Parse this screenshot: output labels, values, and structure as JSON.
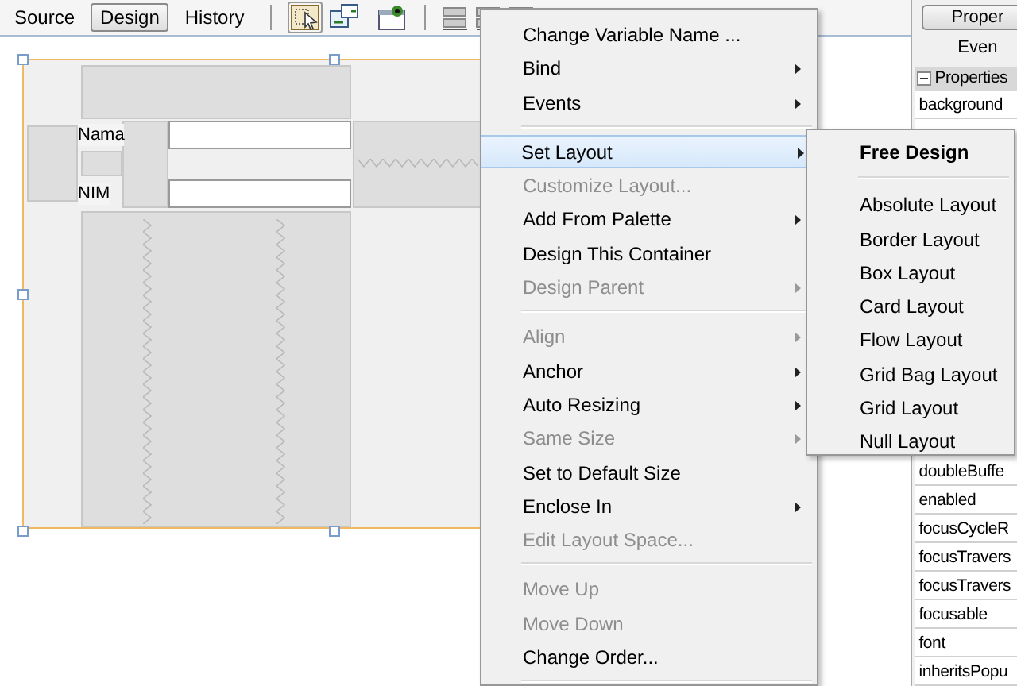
{
  "editor_tabs": [
    {
      "label": "Source",
      "selected": false
    },
    {
      "label": "Design",
      "selected": true
    },
    {
      "label": "History",
      "selected": false
    }
  ],
  "form": {
    "fields": [
      {
        "label": "Nama"
      },
      {
        "label": "NIM"
      }
    ]
  },
  "context_menu": {
    "items": [
      {
        "kind": "item",
        "label": "Change Variable Name ...",
        "disabled": false,
        "submenu": false,
        "highlighted": false
      },
      {
        "kind": "item",
        "label": "Bind",
        "disabled": false,
        "submenu": true,
        "highlighted": false
      },
      {
        "kind": "item",
        "label": "Events",
        "disabled": false,
        "submenu": true,
        "highlighted": false
      },
      {
        "kind": "separator"
      },
      {
        "kind": "item",
        "label": "Set Layout",
        "disabled": false,
        "submenu": true,
        "highlighted": true
      },
      {
        "kind": "item",
        "label": "Customize Layout...",
        "disabled": true,
        "submenu": false,
        "highlighted": false
      },
      {
        "kind": "item",
        "label": "Add From Palette",
        "disabled": false,
        "submenu": true,
        "highlighted": false
      },
      {
        "kind": "item",
        "label": "Design This Container",
        "disabled": false,
        "submenu": false,
        "highlighted": false
      },
      {
        "kind": "item",
        "label": "Design Parent",
        "disabled": true,
        "submenu": true,
        "highlighted": false
      },
      {
        "kind": "separator"
      },
      {
        "kind": "item",
        "label": "Align",
        "disabled": true,
        "submenu": true,
        "highlighted": false
      },
      {
        "kind": "item",
        "label": "Anchor",
        "disabled": false,
        "submenu": true,
        "highlighted": false
      },
      {
        "kind": "item",
        "label": "Auto Resizing",
        "disabled": false,
        "submenu": true,
        "highlighted": false
      },
      {
        "kind": "item",
        "label": "Same Size",
        "disabled": true,
        "submenu": true,
        "highlighted": false
      },
      {
        "kind": "item",
        "label": "Set to Default Size",
        "disabled": false,
        "submenu": false,
        "highlighted": false
      },
      {
        "kind": "item",
        "label": "Enclose In",
        "disabled": false,
        "submenu": true,
        "highlighted": false
      },
      {
        "kind": "item",
        "label": "Edit Layout Space...",
        "disabled": true,
        "submenu": false,
        "highlighted": false
      },
      {
        "kind": "separator"
      },
      {
        "kind": "item",
        "label": "Move Up",
        "disabled": true,
        "submenu": false,
        "highlighted": false
      },
      {
        "kind": "item",
        "label": "Move Down",
        "disabled": true,
        "submenu": false,
        "highlighted": false
      },
      {
        "kind": "item",
        "label": "Change Order...",
        "disabled": false,
        "submenu": false,
        "highlighted": false
      },
      {
        "kind": "separator"
      }
    ]
  },
  "submenu": {
    "items": [
      {
        "kind": "heading",
        "label": "Free Design"
      },
      {
        "kind": "separator"
      },
      {
        "kind": "item",
        "label": "Absolute Layout"
      },
      {
        "kind": "item",
        "label": "Border Layout"
      },
      {
        "kind": "item",
        "label": "Box Layout"
      },
      {
        "kind": "item",
        "label": "Card Layout"
      },
      {
        "kind": "item",
        "label": "Flow Layout"
      },
      {
        "kind": "item",
        "label": "Grid Bag Layout"
      },
      {
        "kind": "item",
        "label": "Grid Layout"
      },
      {
        "kind": "item",
        "label": "Null Layout"
      }
    ]
  },
  "properties_panel": {
    "tabs": [
      {
        "label": "Proper",
        "selected": true
      },
      {
        "label": "Even",
        "selected": false
      }
    ],
    "section": {
      "label": "Properties",
      "expanded": true
    },
    "rows_top": [
      {
        "name": "background"
      }
    ],
    "rows_bottom": [
      {
        "name": "doubleBuffe"
      },
      {
        "name": "enabled"
      },
      {
        "name": "focusCycleR"
      },
      {
        "name": "focusTravers"
      },
      {
        "name": "focusTravers"
      },
      {
        "name": "focusable"
      },
      {
        "name": "font"
      },
      {
        "name": "inheritsPopu"
      }
    ]
  }
}
